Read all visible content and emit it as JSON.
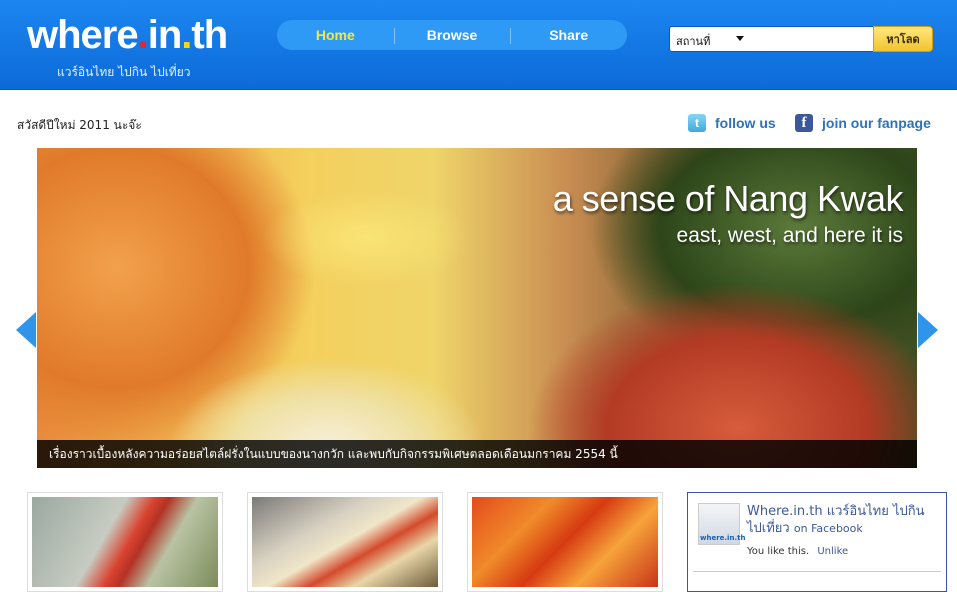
{
  "header": {
    "logo": {
      "part1": "where",
      "dot1": ".",
      "part2": "in",
      "dot2": ".",
      "part3": "th"
    },
    "tagline": "แวร์อินไทย ไปกิน ไปเที่ยว",
    "nav": [
      {
        "label": "Home",
        "active": true
      },
      {
        "label": "Browse",
        "active": false
      },
      {
        "label": "Share",
        "active": false
      }
    ],
    "search": {
      "category": "สถานที่",
      "value": "",
      "button_label": "หาโลด"
    }
  },
  "greeting": "สวัสดีปีใหม่ 2011 นะจ๊ะ",
  "social": {
    "twitter_label": "follow us",
    "facebook_label": "join our fanpage"
  },
  "hero": {
    "title": "a sense of Nang Kwak",
    "subtitle": "east, west, and here it is",
    "caption": "เรื่องราวเบื้องหลังความอร่อยสไตล์ฝรั่งในแบบของนางกวัก และพบกับกิจกรรมพิเศษตลอดเดือนมกราคม 2554 นี้"
  },
  "facebook_box": {
    "pic_label": "where.in.th",
    "name": "Where.in.th แวร์อินไทย ไปกิน ไปเที่ยว",
    "on_facebook": "on Facebook",
    "like_text": "You like this.",
    "unlike_label": "Unlike"
  },
  "colors": {
    "header_blue": "#1c86f0",
    "nav_active": "#f2e84a",
    "link_blue": "#2c73b8",
    "facebook_blue": "#3b5998"
  }
}
